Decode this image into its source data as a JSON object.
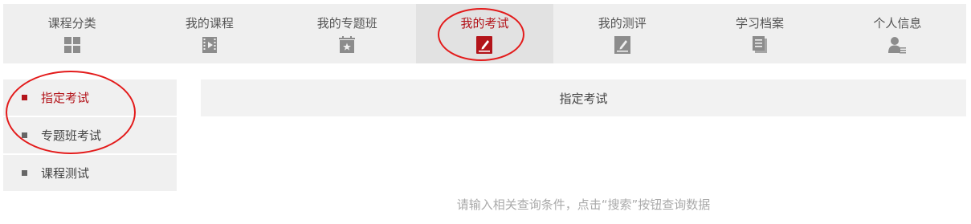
{
  "nav": {
    "items": [
      {
        "label": "课程分类",
        "icon": "grid-icon"
      },
      {
        "label": "我的课程",
        "icon": "video-icon"
      },
      {
        "label": "我的专题班",
        "icon": "star-board-icon"
      },
      {
        "label": "我的考试",
        "icon": "exam-pencil-icon"
      },
      {
        "label": "我的测评",
        "icon": "edit-note-icon"
      },
      {
        "label": "学习档案",
        "icon": "document-stack-icon"
      },
      {
        "label": "个人信息",
        "icon": "user-icon"
      }
    ],
    "active_index": 3
  },
  "sidebar": {
    "items": [
      {
        "label": "指定考试"
      },
      {
        "label": "专题班考试"
      },
      {
        "label": "课程测试"
      }
    ],
    "active_index": 0
  },
  "main": {
    "header_title": "指定考试",
    "hint": "请输入相关查询条件，点击“搜索”按钮查询数据"
  },
  "colors": {
    "accent": "#b3141a",
    "annotation_circle": "#e31b1b",
    "nav_bg": "#efefef",
    "nav_active_bg": "#e2e2e2",
    "icon_gray": "#8c8c8c"
  }
}
